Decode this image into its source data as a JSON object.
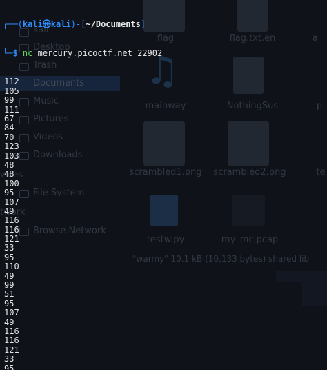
{
  "background_file_manager": {
    "sidebar": {
      "places": [
        "kali",
        "Desktop",
        "Trash",
        "Documents",
        "Music",
        "Pictures",
        "Videos",
        "Downloads"
      ],
      "active": "Documents",
      "devices_label": "vices",
      "devices": [
        "File System"
      ],
      "network_label": "twork",
      "network": [
        "Browse Network"
      ]
    },
    "files": [
      {
        "name": "flag"
      },
      {
        "name": "flag.txt.en"
      },
      {
        "name": "a"
      },
      {
        "name": "mainway"
      },
      {
        "name": "NothingSus"
      },
      {
        "name": "p"
      },
      {
        "name": "scrambled1.png"
      },
      {
        "name": "scrambled2.png"
      },
      {
        "name": "te"
      },
      {
        "name": "testw.py"
      },
      {
        "name": "my_mc.pcap"
      }
    ],
    "status_text": "\"warmy\" 10.1 kB (10,133 bytes) shared lib"
  },
  "terminal": {
    "prompt": {
      "box_top": "┌──(",
      "user": "kali㉿kali",
      "mid": ")-[",
      "cwd": "~/Documents",
      "end": "]",
      "box_bottom": "└─",
      "dollar": "$",
      "command_name": "nc",
      "command_args": "mercury.picoctf.net 22902"
    },
    "output": [
      "112",
      "105",
      "99",
      "111",
      "67",
      "84",
      "70",
      "123",
      "103",
      "48",
      "48",
      "100",
      "95",
      "107",
      "49",
      "116",
      "116",
      "121",
      "33",
      "95",
      "110",
      "49",
      "99",
      "51",
      "95",
      "107",
      "49",
      "116",
      "116",
      "121",
      "33",
      "95"
    ]
  },
  "colors": {
    "prompt_blue": "#2f8fff",
    "command_green": "#5fd75f",
    "text": "#e6e6e6",
    "background": "#0f1219"
  }
}
